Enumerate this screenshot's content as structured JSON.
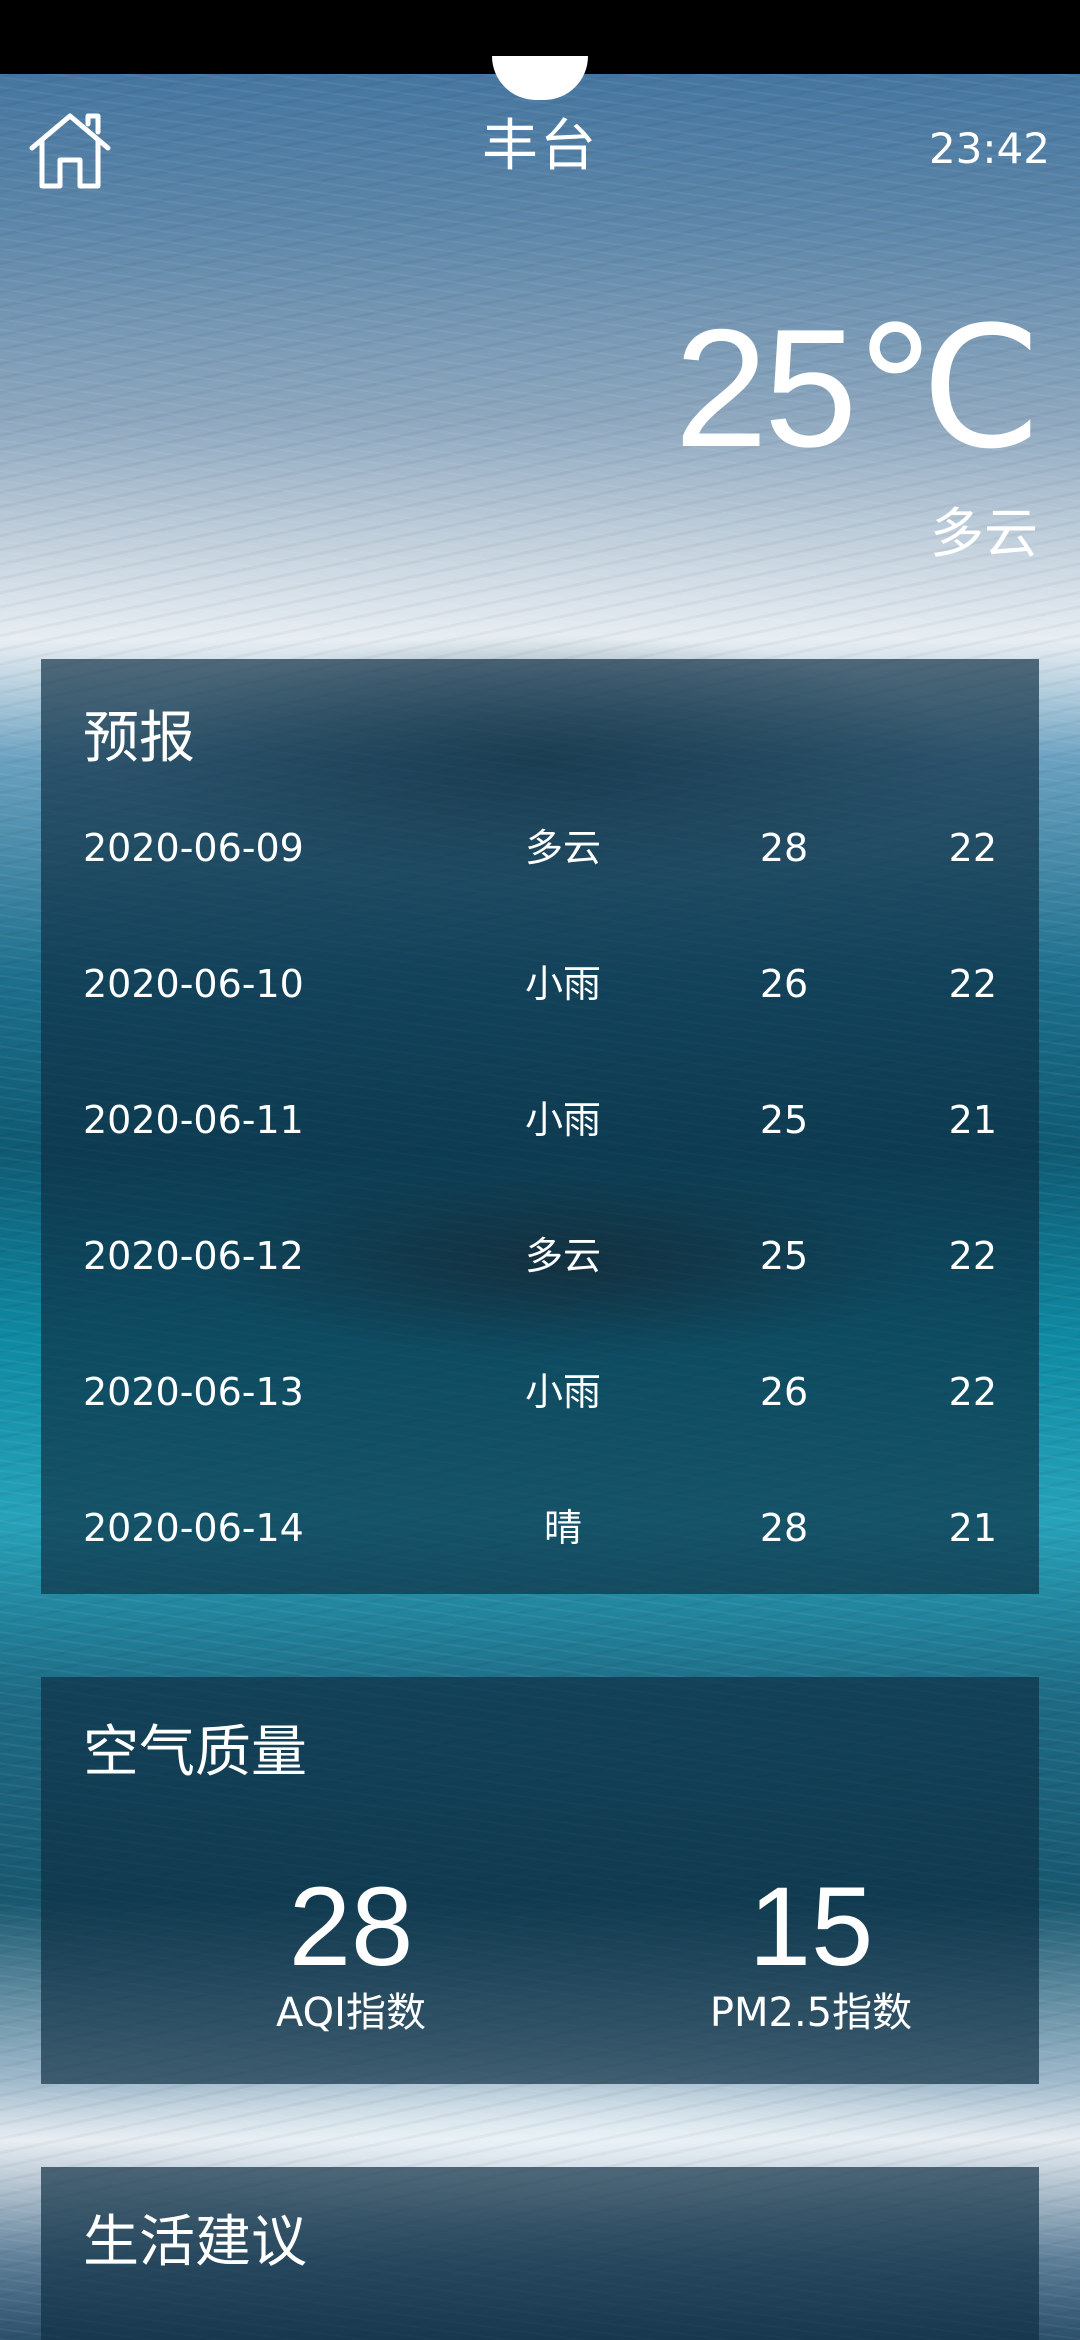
{
  "header": {
    "home_icon": "home-icon",
    "city": "丰台",
    "update_time": "23:42"
  },
  "now": {
    "temperature": "25℃",
    "condition": "多云"
  },
  "forecast": {
    "title": "预报",
    "days": [
      {
        "date": "2020-06-09",
        "weather": "多云",
        "max": "28",
        "min": "22"
      },
      {
        "date": "2020-06-10",
        "weather": "小雨",
        "max": "26",
        "min": "22"
      },
      {
        "date": "2020-06-11",
        "weather": "小雨",
        "max": "25",
        "min": "21"
      },
      {
        "date": "2020-06-12",
        "weather": "多云",
        "max": "25",
        "min": "22"
      },
      {
        "date": "2020-06-13",
        "weather": "小雨",
        "max": "26",
        "min": "22"
      },
      {
        "date": "2020-06-14",
        "weather": "晴",
        "max": "28",
        "min": "21"
      }
    ]
  },
  "aqi": {
    "title": "空气质量",
    "aqi_value": "28",
    "aqi_label": "AQI指数",
    "pm25_value": "15",
    "pm25_label": "PM2.5指数"
  },
  "advice": {
    "title": "生活建议"
  },
  "colors": {
    "text": "#ffffff",
    "card": "#0e2d42",
    "status_bar": "#000000"
  }
}
